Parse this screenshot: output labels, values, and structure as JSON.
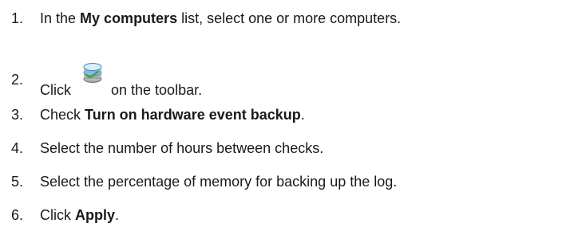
{
  "steps": [
    {
      "number": "1.",
      "before": "In the ",
      "bold": "My computers",
      "after": " list, select one or more computers."
    },
    {
      "number": "2.",
      "before": "Click",
      "icon": "hardware-event-backup-toolbar-icon",
      "after": "on the toolbar."
    },
    {
      "number": "3.",
      "before": "Check ",
      "bold": "Turn on hardware event backup",
      "after": "."
    },
    {
      "number": "4.",
      "text": "Select the number of hours between checks."
    },
    {
      "number": "5.",
      "text": "Select the percentage of memory for backing up the log."
    },
    {
      "number": "6.",
      "before": "Click ",
      "bold": "Apply",
      "after": "."
    }
  ],
  "colors": {
    "text": "#1a1a1a",
    "background": "#ffffff"
  }
}
